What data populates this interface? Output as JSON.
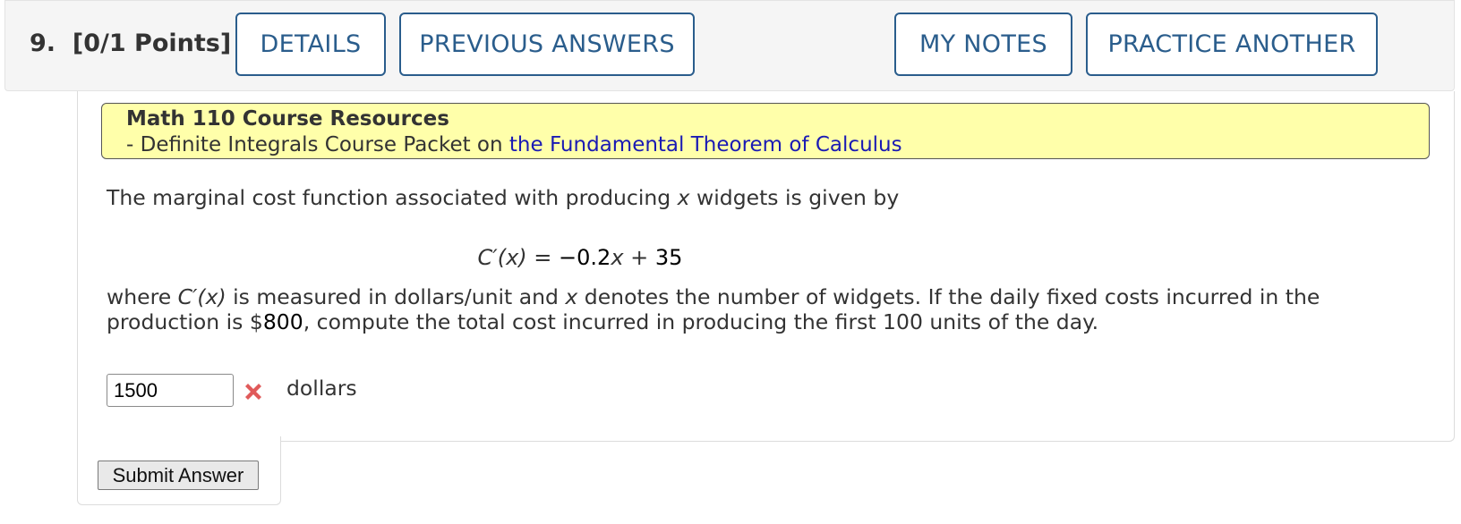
{
  "question": {
    "number": "9.",
    "points": "[0/1 Points]"
  },
  "header_buttons": {
    "details": "DETAILS",
    "previous_answers": "PREVIOUS ANSWERS",
    "my_notes": "MY NOTES",
    "practice_another": "PRACTICE ANOTHER"
  },
  "resources": {
    "title": "Math 110 Course Resources",
    "line_prefix": "- Definite Integrals Course Packet on ",
    "link_text": "the Fundamental Theorem of Calculus"
  },
  "problem": {
    "intro_before": "The marginal cost function associated with producing ",
    "intro_var": "x",
    "intro_after": " widgets is given by",
    "equation_lhs": "C′(x)",
    "equation_eq": " = ",
    "equation_neg": "−0.2",
    "equation_var": "x",
    "equation_plus": " + ",
    "equation_const": "35",
    "line1_a": "where ",
    "line1_func": "C′(x)",
    "line1_b": " is measured in dollars/unit and ",
    "line1_var": "x",
    "line1_c": " denotes the number of widgets. If the daily fixed costs incurred in the",
    "line2_a": "production is $",
    "line2_cost": "800",
    "line2_b": ", compute the total cost incurred in producing the first 100 units of the day."
  },
  "answer": {
    "value": "1500",
    "status_icon": "x-mark-icon",
    "units": "dollars"
  },
  "submit_label": "Submit Answer",
  "colors": {
    "button_border": "#2a5d8c",
    "resource_bg": "#ffffaa",
    "link": "#1a1ab4",
    "wrong": "#e05a5a"
  }
}
